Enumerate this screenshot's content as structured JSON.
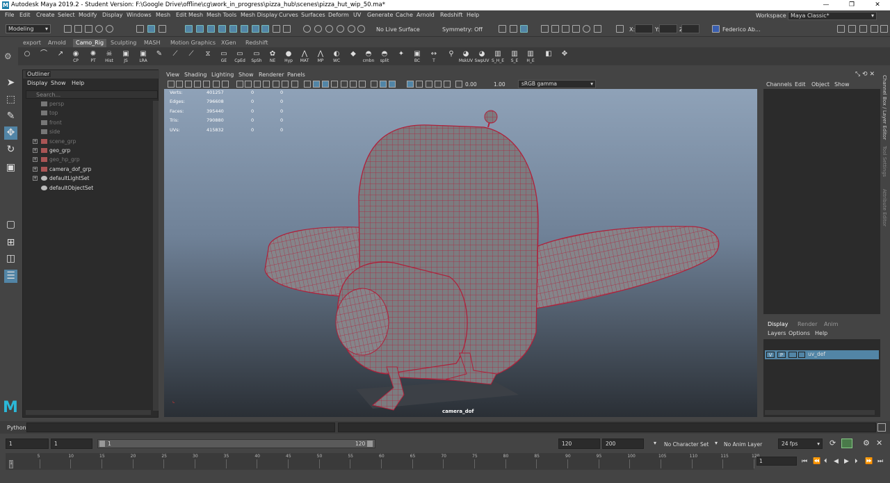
{
  "window": {
    "title": "Autodesk Maya 2019.2 - Student Version: F:\\Google Drive\\offline\\cg\\work_in_progress\\pizza_hub\\scenes\\pizza_hut_wip_50.ma*",
    "logo": "M",
    "controls": [
      "—",
      "❐",
      "✕"
    ]
  },
  "menubar": {
    "items": [
      "File",
      "Edit",
      "Create",
      "Select",
      "Modify",
      "Display",
      "Windows",
      "Mesh",
      "Edit Mesh",
      "Mesh Tools",
      "Mesh Display",
      "Curves",
      "Surfaces",
      "Deform",
      "UV",
      "Generate",
      "Cache",
      "Arnold",
      "Redshift",
      "Help"
    ],
    "workspace_label": "Workspace :",
    "workspace_value": "Maya Classic*"
  },
  "statusline": {
    "mode": "Modeling",
    "live_surface": "No Live Surface",
    "symmetry": "Symmetry: Off",
    "x_label": "X:",
    "y_label": "Y:",
    "z_label": "Z:",
    "user": "Federico Ab..."
  },
  "shelf": {
    "tabs": [
      "export",
      "Arnold",
      "Camo_Rig",
      "Sculpting",
      "MASH",
      "Motion Graphics",
      "XGen",
      "Redshift"
    ],
    "active_tab": "Camo_Rig",
    "buttons": [
      {
        "label": "",
        "glyph": "○"
      },
      {
        "label": "",
        "glyph": "⌒"
      },
      {
        "label": "",
        "glyph": "↗"
      },
      {
        "label": "CP",
        "glyph": "◉"
      },
      {
        "label": "PT",
        "glyph": "✺"
      },
      {
        "label": "Hist",
        "glyph": "☠"
      },
      {
        "label": "JS",
        "glyph": "▣"
      },
      {
        "label": "LRA",
        "glyph": "▣"
      },
      {
        "label": "",
        "glyph": "✎"
      },
      {
        "label": "",
        "glyph": "⟋"
      },
      {
        "label": "",
        "glyph": "⟋"
      },
      {
        "label": "",
        "glyph": "⧖"
      },
      {
        "label": "GE",
        "glyph": "▭"
      },
      {
        "label": "CpEd",
        "glyph": "▭"
      },
      {
        "label": "SpSh",
        "glyph": "▭"
      },
      {
        "label": "NE",
        "glyph": "✿"
      },
      {
        "label": "Hyp",
        "glyph": "●"
      },
      {
        "label": "MAT",
        "glyph": "⋀"
      },
      {
        "label": "MP",
        "glyph": "⋀"
      },
      {
        "label": "WC",
        "glyph": "◐"
      },
      {
        "label": "",
        "glyph": "◆"
      },
      {
        "label": "cmbn",
        "glyph": "◓"
      },
      {
        "label": "split",
        "glyph": "◓"
      },
      {
        "label": "",
        "glyph": "✦"
      },
      {
        "label": "BC",
        "glyph": "▣"
      },
      {
        "label": "T",
        "glyph": "↔"
      },
      {
        "label": "",
        "glyph": "⚲"
      },
      {
        "label": "MskUV",
        "glyph": "◕"
      },
      {
        "label": "SwpUV",
        "glyph": "◕"
      },
      {
        "label": "S_H_E",
        "glyph": "▥"
      },
      {
        "label": "S_E",
        "glyph": "▥"
      },
      {
        "label": "H_E",
        "glyph": "▥"
      },
      {
        "label": "",
        "glyph": "◧"
      },
      {
        "label": "",
        "glyph": "✥"
      }
    ]
  },
  "outliner": {
    "title": "Outliner",
    "menu": [
      "Display",
      "Show",
      "Help"
    ],
    "search_placeholder": "Search...",
    "items": [
      {
        "name": "persp",
        "dim": true,
        "expandable": false,
        "icon": "camera-icon"
      },
      {
        "name": "top",
        "dim": true,
        "expandable": false,
        "icon": "camera-icon"
      },
      {
        "name": "front",
        "dim": true,
        "expandable": false,
        "icon": "camera-icon"
      },
      {
        "name": "side",
        "dim": true,
        "expandable": false,
        "icon": "camera-icon"
      },
      {
        "name": "scene_grp",
        "dim": true,
        "expandable": true,
        "icon": "group-icon"
      },
      {
        "name": "geo_grp",
        "dim": false,
        "expandable": true,
        "icon": "group-icon"
      },
      {
        "name": "geo_hp_grp",
        "dim": true,
        "expandable": true,
        "icon": "group-icon"
      },
      {
        "name": "camera_dof_grp",
        "dim": false,
        "expandable": true,
        "icon": "group-icon"
      },
      {
        "name": "defaultLightSet",
        "dim": false,
        "expandable": true,
        "icon": "set-icon"
      },
      {
        "name": "defaultObjectSet",
        "dim": false,
        "expandable": false,
        "icon": "set-icon"
      }
    ]
  },
  "viewport": {
    "menu": [
      "View",
      "Shading",
      "Lighting",
      "Show",
      "Renderer",
      "Panels"
    ],
    "exposure": "0.00",
    "gamma": "1.00",
    "color_space": "sRGB gamma",
    "camera_name": "camera_dof",
    "hud": [
      {
        "label": "Verts:",
        "v1": "401257",
        "v2": "0",
        "v3": "0"
      },
      {
        "label": "Edges:",
        "v1": "796608",
        "v2": "0",
        "v3": "0"
      },
      {
        "label": "Faces:",
        "v1": "395440",
        "v2": "0",
        "v3": "0"
      },
      {
        "label": "Tris:",
        "v1": "790880",
        "v2": "0",
        "v3": "0"
      },
      {
        "label": "UVs:",
        "v1": "415832",
        "v2": "0",
        "v3": "0"
      }
    ],
    "bg_top": "#8fa2b8",
    "bg_bottom": "#2a2f35",
    "wire_color": "#c0203a"
  },
  "channelbox": {
    "menu": [
      "Channels",
      "Edit",
      "Object",
      "Show"
    ],
    "side_tabs": [
      "Channel Box / Layer Editor",
      "Tool Settings",
      "Attribute Editor"
    ]
  },
  "layers": {
    "tabs": [
      "Display",
      "Render",
      "Anim"
    ],
    "active_tab": "Display",
    "menu": [
      "Layers",
      "Options",
      "Help"
    ],
    "layer": {
      "v": "V",
      "p": "P",
      "name": "uv_def"
    }
  },
  "cmdline": {
    "lang": "Python"
  },
  "range": {
    "start": "1",
    "inner_start": "1",
    "slider_start": "1",
    "slider_end": "120",
    "end": "120",
    "outer_end": "200",
    "character_set": "No Character Set",
    "anim_layer": "No Anim Layer",
    "fps": "24 fps"
  },
  "timeline": {
    "ticks": [
      "5",
      "10",
      "15",
      "20",
      "25",
      "30",
      "35",
      "40",
      "45",
      "50",
      "55",
      "60",
      "65",
      "70",
      "75",
      "80",
      "85",
      "90",
      "95",
      "100",
      "105",
      "110",
      "115",
      "120"
    ],
    "start_label": "1",
    "current_frame": "1"
  },
  "colors": {
    "accent": "#5285a6",
    "panel": "#444444",
    "field": "#2b2b2b"
  }
}
